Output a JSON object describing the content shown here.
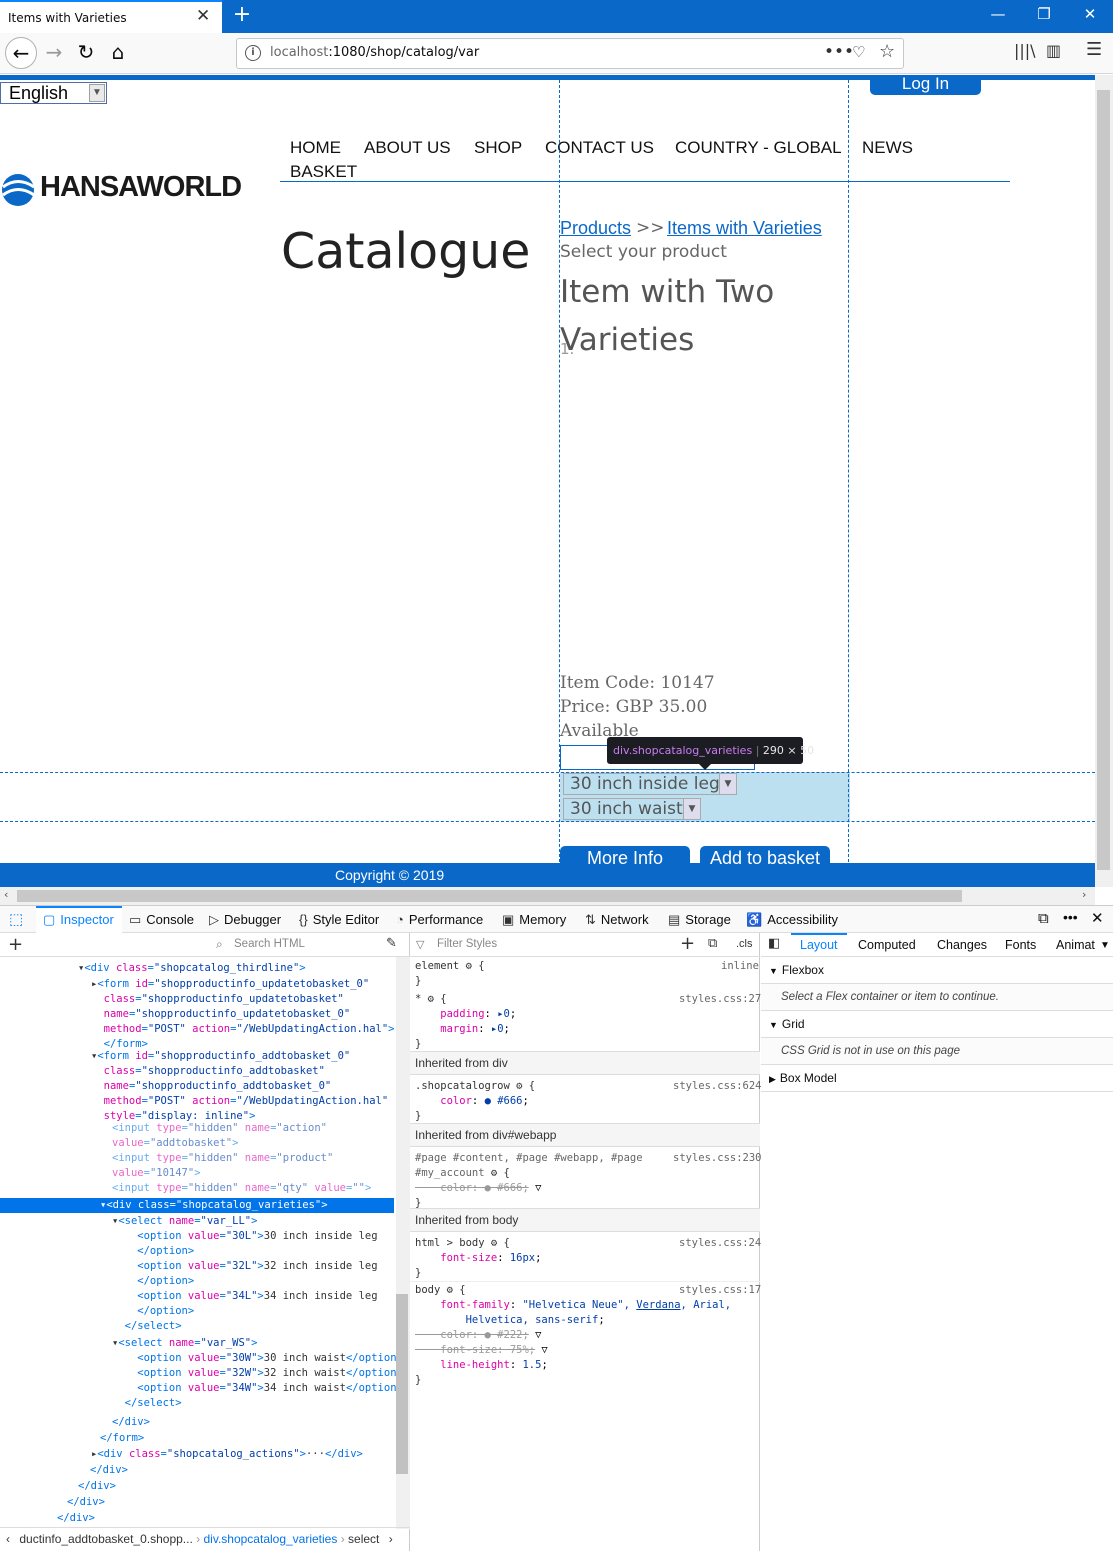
{
  "browser": {
    "tab_title": "Items with Varieties",
    "url_host": "localhost",
    "url_path": ":1080/shop/catalog/var"
  },
  "page": {
    "language": "English",
    "login": "Log In",
    "logo": "HANSAWORLD",
    "menu": [
      "HOME",
      "ABOUT US",
      "SHOP",
      "CONTACT US",
      "COUNTRY - GLOBAL",
      "NEWS",
      "BASKET"
    ],
    "heading": "Catalogue",
    "crumb_products": "Products",
    "crumb_sep": ">>",
    "crumb_items": "Items with Varieties",
    "select_prompt": "Select your product",
    "item_title": "Item with Two Varieties",
    "list_marker": "1.",
    "item_code": "Item Code: 10147",
    "price": "Price: GBP 35.00",
    "availability": "Available",
    "variety_leg": "30 inch inside leg",
    "variety_waist": "30 inch waist",
    "more_info": "More Info",
    "add_to_basket": "Add to basket",
    "copyright": "Copyright © 2019",
    "tooltip_class": "div.shopcatalog_varieties",
    "tooltip_dims": "290 × 50"
  },
  "devtools": {
    "tabs": [
      "Inspector",
      "Console",
      "Debugger",
      "Style Editor",
      "Performance",
      "Memory",
      "Network",
      "Storage",
      "Accessibility"
    ],
    "search_placeholder": "Search HTML",
    "filter_placeholder": "Filter Styles",
    "cls": ".cls",
    "breadcrumbs": [
      "ductinfo_addtobasket_0.shopp...",
      "div.shopcatalog_varieties",
      "select"
    ],
    "layout_tabs": [
      "Layout",
      "Computed",
      "Changes",
      "Fonts",
      "Animat"
    ],
    "flexbox_label": "Flexbox",
    "flexbox_note": "Select a Flex container or item to continue.",
    "grid_label": "Grid",
    "grid_note": "CSS Grid is not in use on this page",
    "boxmodel_label": "Box Model",
    "inherited_div": "Inherited from div",
    "inherited_webapp": "Inherited from div#webapp",
    "inherited_body": "Inherited from body",
    "element_rule": "element",
    "inline": "inline",
    "styles_css_27": "styles.css:27",
    "styles_css_624": "styles.css:624",
    "styles_css_230": "styles.css:230",
    "styles_css_24": "styles.css:24",
    "styles_css_17": "styles.css:17"
  },
  "colors": {
    "accent": "#0a68c8",
    "selection": "#0074e8",
    "highlight": "#86c7e6"
  }
}
